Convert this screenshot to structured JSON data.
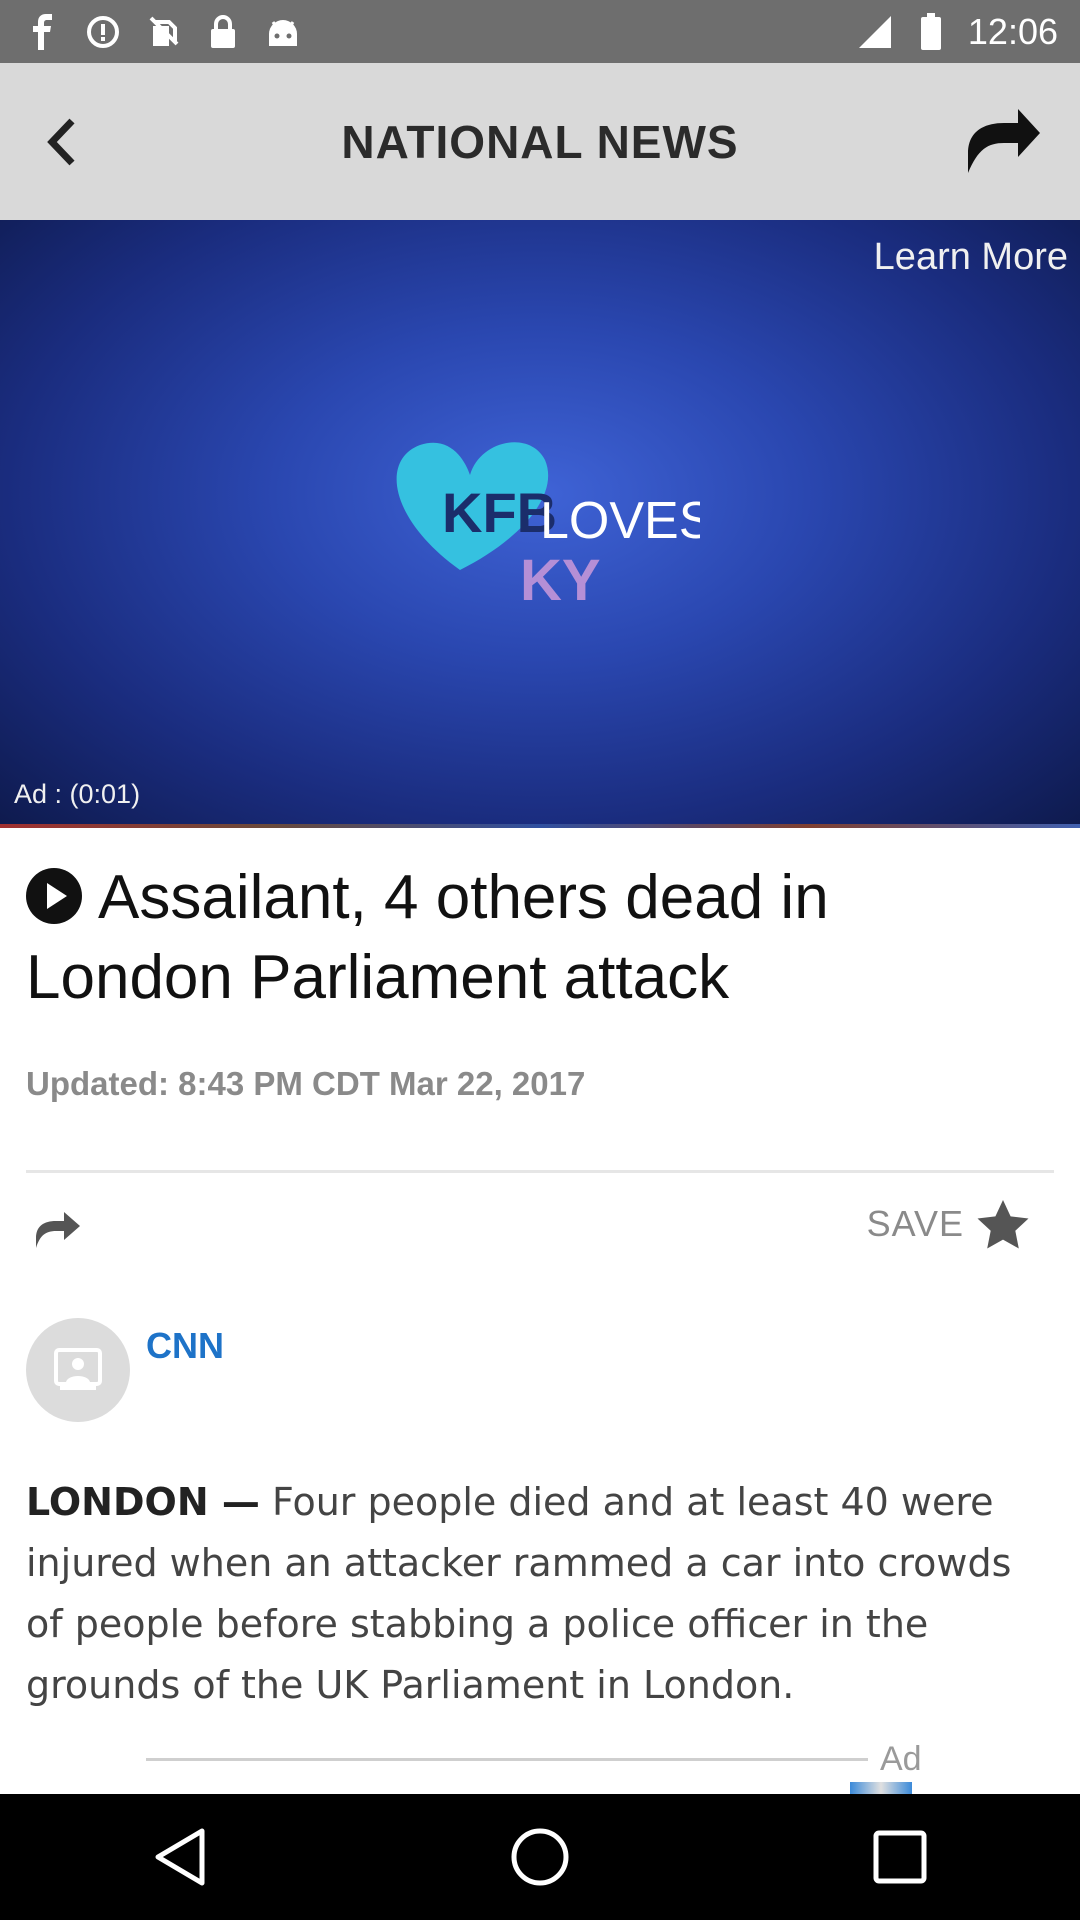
{
  "status_bar": {
    "time": "12:06",
    "icons": [
      "facebook-icon",
      "data-saver-icon",
      "no-sim-icon",
      "lock-icon",
      "android-icon",
      "signal-icon",
      "battery-icon"
    ]
  },
  "app_bar": {
    "title": "NATIONAL NEWS",
    "back_icon": "chevron-left-icon",
    "share_icon": "share-arrow-icon"
  },
  "video_ad": {
    "learn_more": "Learn More",
    "ad_timer": "Ad : (0:01)",
    "logo_line1": "KFB",
    "logo_line2": "LOVES",
    "logo_line3": "KY"
  },
  "article": {
    "headline": "Assailant, 4 others dead in London Parliament attack",
    "updated": "Updated: 8:43 PM CDT Mar 22, 2017",
    "save_label": "SAVE",
    "source": "CNN",
    "dateline": "LONDON —",
    "body": "Four people died and at least 40 were injured when an attacker rammed a car into crowds of people before stabbing a police officer in the grounds of the UK Parliament in London."
  },
  "inline_ad": {
    "label": "Ad"
  },
  "colors": {
    "app_bar_bg": "#d9d9d9",
    "status_bar_bg": "#6e6e6e",
    "source_link": "#1e73c8",
    "logo_heart": "#35c1e0",
    "logo_ky": "#b58fd6"
  }
}
